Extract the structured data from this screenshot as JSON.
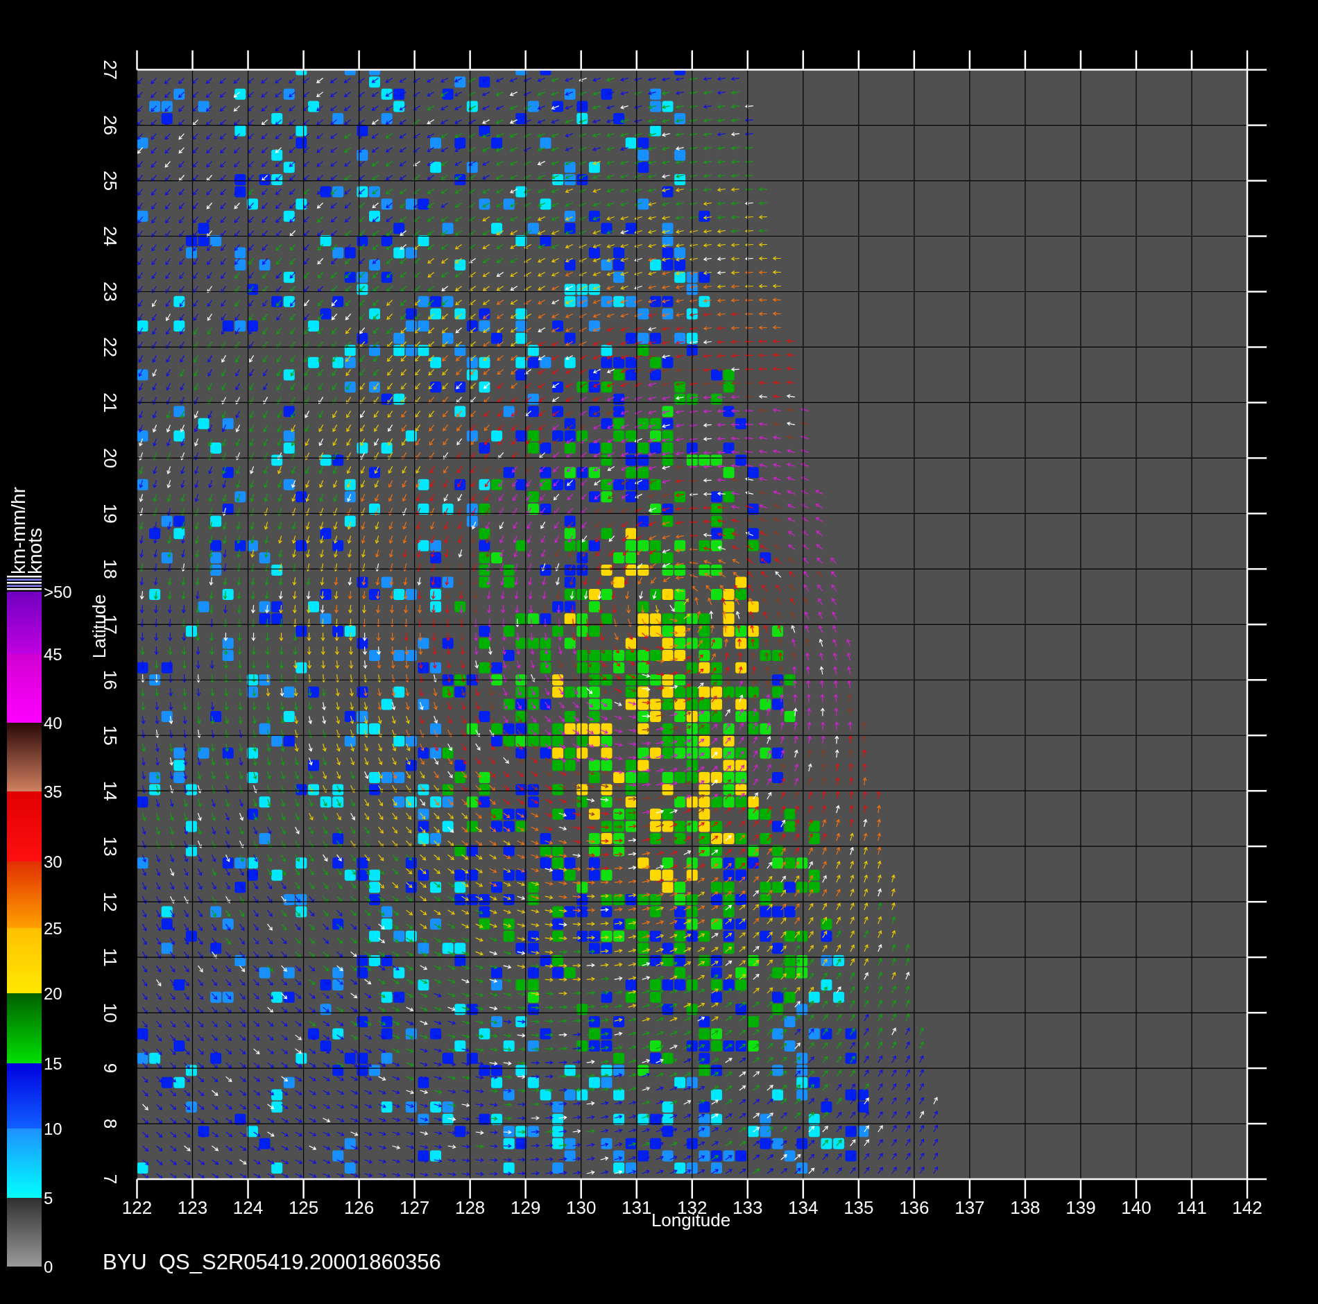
{
  "plot": {
    "x_axis": {
      "title": "Longitude",
      "tick_labels": [
        "122",
        "123",
        "124",
        "125",
        "126",
        "127",
        "128",
        "129",
        "130",
        "131",
        "132",
        "133",
        "134",
        "135",
        "136",
        "137",
        "138",
        "139",
        "140",
        "141",
        "142"
      ]
    },
    "y_axis": {
      "title": "Latitude",
      "tick_labels": [
        "7",
        "8",
        "9",
        "10",
        "11",
        "12",
        "13",
        "14",
        "15",
        "16",
        "17",
        "18",
        "19",
        "20",
        "21",
        "22",
        "23",
        "24",
        "25",
        "26",
        "27"
      ]
    }
  },
  "legend": {
    "units": [
      "km-mm/hr",
      "knots"
    ],
    "labels": [
      ">50",
      "45",
      "40",
      "35",
      "30",
      "25",
      "20",
      "15",
      "10",
      "5",
      "0"
    ]
  },
  "caption": "BYU  QS_S2R05419.20001860356"
}
